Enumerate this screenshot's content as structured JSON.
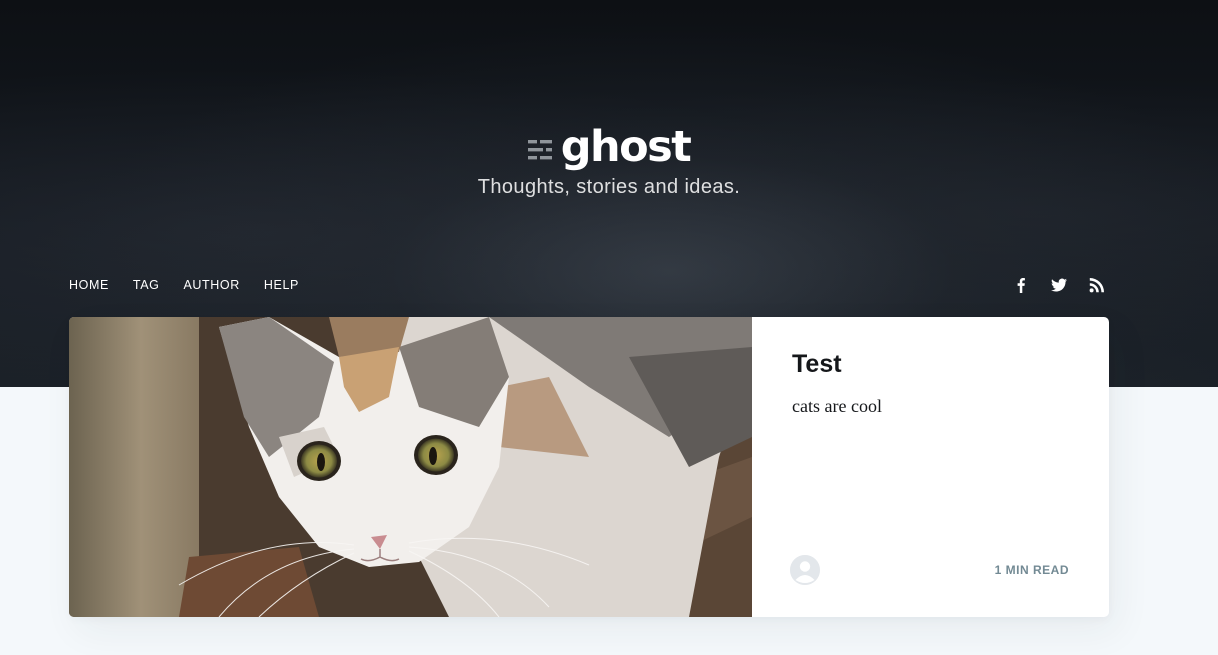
{
  "site": {
    "logo_text": "ghost",
    "description": "Thoughts, stories and ideas."
  },
  "nav": {
    "items": [
      {
        "label": "HOME"
      },
      {
        "label": "TAG"
      },
      {
        "label": "AUTHOR"
      },
      {
        "label": "HELP"
      }
    ]
  },
  "social": {
    "icons": [
      "facebook-icon",
      "twitter-icon",
      "rss-icon"
    ]
  },
  "post": {
    "title": "Test",
    "excerpt": "cats are cool",
    "reading_time": "1 MIN READ",
    "image_subject": "cat"
  },
  "colors": {
    "hero_bg": "#101419",
    "page_bg": "#f4f8fb",
    "title": "#15171a",
    "meta": "#738a94"
  }
}
